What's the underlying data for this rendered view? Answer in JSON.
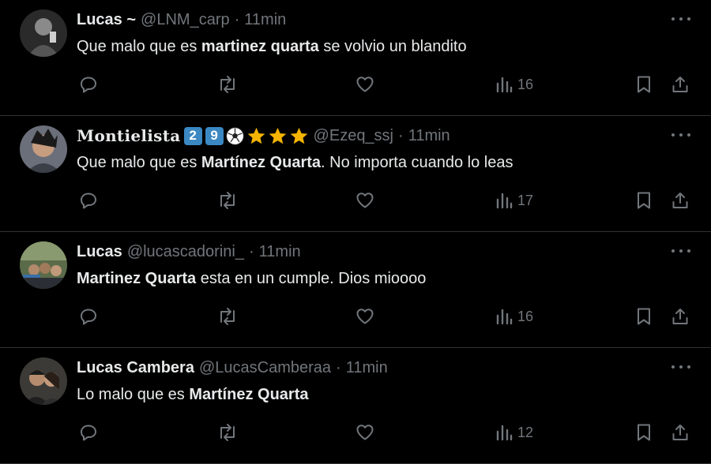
{
  "tweets": [
    {
      "name": "Lucas ~",
      "handle": "@LNM_carp",
      "time": "11min",
      "text_pre": "Que malo que es ",
      "text_bold": "martinez quarta",
      "text_post": " se volvio un blandito",
      "views": "16"
    },
    {
      "name": "Montielista",
      "badges": [
        "2",
        "9"
      ],
      "handle": "@Ezeq_ssj",
      "time": "11min",
      "text_pre": "Que malo que es ",
      "text_bold": "Martínez Quarta",
      "text_post": ". No importa cuando lo leas",
      "views": "17"
    },
    {
      "name": "Lucas",
      "handle": "@lucascadorini_",
      "time": "11min",
      "text_pre": "",
      "text_bold": "Martinez Quarta",
      "text_post": " esta en un cumple. Dios mioooo",
      "views": "16"
    },
    {
      "name": "Lucas Cambera",
      "handle": "@LucasCamberaa",
      "time": "11min",
      "text_pre": "Lo malo que es ",
      "text_bold": "Martínez Quarta",
      "text_post": "",
      "views": "12"
    }
  ],
  "separator": "·",
  "colors": {
    "background": "#000000",
    "text": "#e7e9ea",
    "muted": "#71767b",
    "border": "#2f3336",
    "badge": "#3b88c3",
    "star": "#f4b400"
  },
  "icons": [
    "reply-icon",
    "retweet-icon",
    "like-icon",
    "views-icon",
    "bookmark-icon",
    "share-icon",
    "more-icon",
    "soccer-ball-icon",
    "star-icon"
  ]
}
